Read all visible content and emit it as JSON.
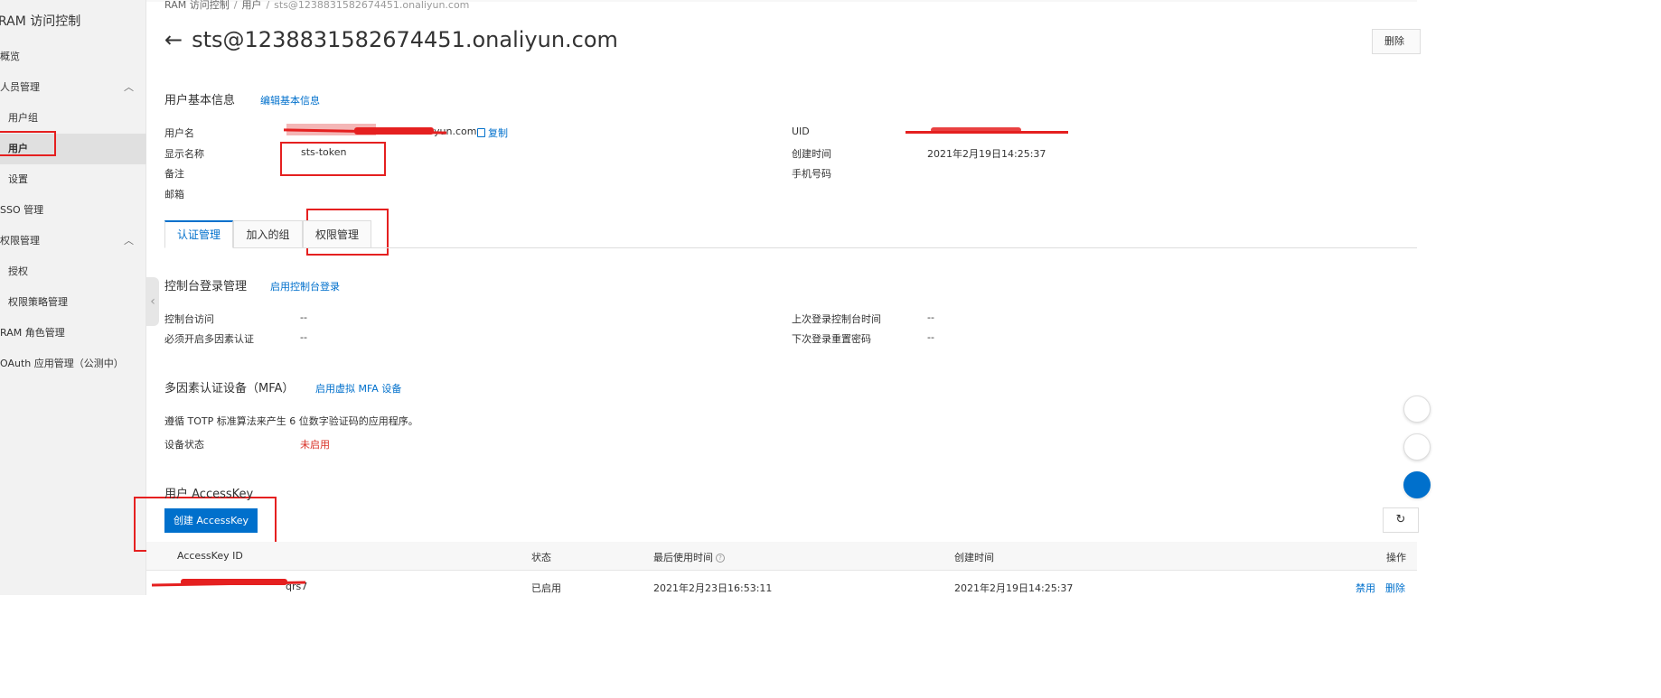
{
  "sidebar": {
    "title": "RAM 访问控制",
    "items": [
      {
        "label": "概览",
        "level": "top"
      },
      {
        "label": "人员管理",
        "level": "top",
        "expandable": true
      },
      {
        "label": "用户组",
        "level": "sub"
      },
      {
        "label": "用户",
        "level": "sub",
        "active": true
      },
      {
        "label": "设置",
        "level": "sub"
      },
      {
        "label": "SSO 管理",
        "level": "top"
      },
      {
        "label": "权限管理",
        "level": "top",
        "expandable": true
      },
      {
        "label": "授权",
        "level": "sub"
      },
      {
        "label": "权限策略管理",
        "level": "sub"
      },
      {
        "label": "RAM 角色管理",
        "level": "top"
      },
      {
        "label": "OAuth 应用管理（公测中）",
        "level": "top"
      }
    ],
    "chevron_up": "︿",
    "collapse_handle": "‹"
  },
  "breadcrumb": {
    "items": [
      "RAM 访问控制",
      "用户",
      "sts@1238831582674451.onaliyun.com"
    ],
    "separator": "/"
  },
  "header": {
    "back_arrow": "←",
    "title": "sts@1238831582674451.onaliyun.com",
    "delete_label": "删除"
  },
  "basic_info": {
    "heading": "用户基本信息",
    "edit_link": "编辑基本信息",
    "username_label": "用户名",
    "username_value_suffix": "yun.com",
    "copy_label": "复制",
    "display_name_label": "显示名称",
    "display_name_value": "sts-token",
    "note_label": "备注",
    "email_label": "邮箱",
    "uid_label": "UID",
    "created_label": "创建时间",
    "created_value": "2021年2月19日14:25:37",
    "phone_label": "手机号码"
  },
  "tabs": [
    {
      "label": "认证管理",
      "active": true
    },
    {
      "label": "加入的组",
      "active": false
    },
    {
      "label": "权限管理",
      "active": false
    }
  ],
  "console_login": {
    "heading": "控制台登录管理",
    "enable_link": "启用控制台登录",
    "access_label": "控制台访问",
    "access_value": "--",
    "mfa_required_label": "必须开启多因素认证",
    "mfa_required_value": "--",
    "last_login_label": "上次登录控制台时间",
    "last_login_value": "--",
    "next_reset_label": "下次登录重置密码",
    "next_reset_value": "--"
  },
  "mfa": {
    "heading": "多因素认证设备（MFA）",
    "enable_link": "启用虚拟 MFA 设备",
    "description": "遵循 TOTP 标准算法来产生 6 位数字验证码的应用程序。",
    "status_label": "设备状态",
    "status_value": "未启用"
  },
  "accesskey": {
    "heading": "用户 AccessKey",
    "create_button": "创建 AccessKey",
    "refresh_icon": "↻",
    "columns": [
      "AccessKey ID",
      "状态",
      "最后使用时间",
      "创建时间",
      "操作"
    ],
    "help_glyph": "?",
    "rows": [
      {
        "id_suffix": "qrs7",
        "status": "已启用",
        "last_used": "2021年2月23日16:53:11",
        "created": "2021年2月19日14:25:37",
        "actions": [
          "禁用",
          "删除"
        ]
      }
    ]
  },
  "colors": {
    "link": "#0070cc",
    "primary": "#0070cc",
    "danger": "#d93026",
    "annotation": "#e52020"
  }
}
